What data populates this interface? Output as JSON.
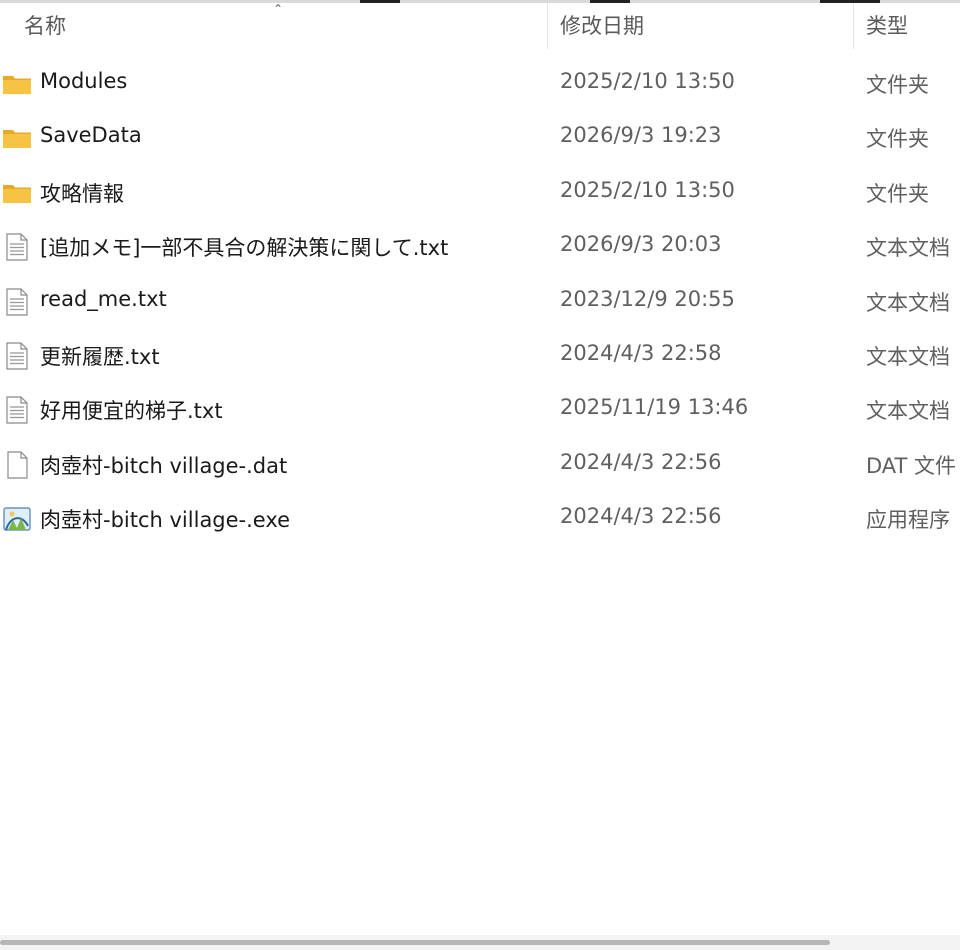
{
  "columns": {
    "name": "名称",
    "date_modified": "修改日期",
    "type": "类型"
  },
  "files": [
    {
      "icon": "folder-icon",
      "name": "Modules",
      "date": "2025/2/10 13:50",
      "type": "文件夹"
    },
    {
      "icon": "folder-icon",
      "name": "SaveData",
      "date": "2026/9/3 19:23",
      "type": "文件夹"
    },
    {
      "icon": "folder-icon",
      "name": "攻略情報",
      "date": "2025/2/10 13:50",
      "type": "文件夹"
    },
    {
      "icon": "text-file-icon",
      "name": "[追加メモ]一部不具合の解決策に関して.txt",
      "date": "2026/9/3 20:03",
      "type": "文本文档"
    },
    {
      "icon": "text-file-icon",
      "name": "read_me.txt",
      "date": "2023/12/9 20:55",
      "type": "文本文档"
    },
    {
      "icon": "text-file-icon",
      "name": "更新履歴.txt",
      "date": "2024/4/3 22:58",
      "type": "文本文档"
    },
    {
      "icon": "text-file-icon",
      "name": "好用便宜的梯子.txt",
      "date": "2025/11/19 13:46",
      "type": "文本文档"
    },
    {
      "icon": "blank-file-icon",
      "name": "肉壺村-bitch village-.dat",
      "date": "2024/4/3 22:56",
      "type": "DAT 文件"
    },
    {
      "icon": "app-exe-icon",
      "name": "肉壺村-bitch village-.exe",
      "date": "2024/4/3 22:56",
      "type": "应用程序"
    }
  ],
  "colors": {
    "folder": "#f6c343",
    "folder_dark": "#e8a92b",
    "text_icon_border": "#8a8a8a",
    "scroll_thumb": "#b6b6b6"
  }
}
